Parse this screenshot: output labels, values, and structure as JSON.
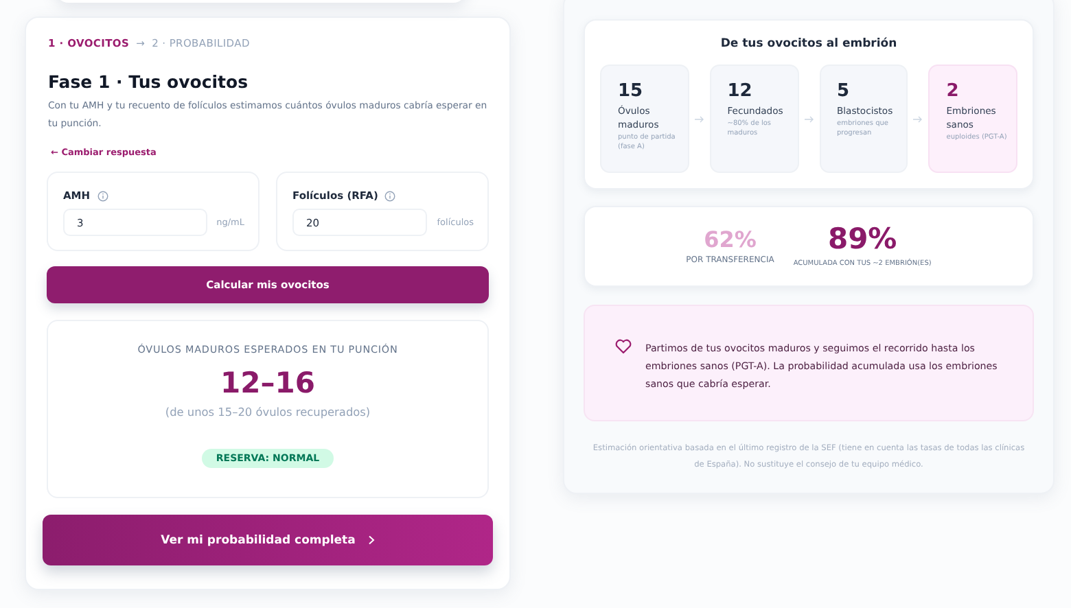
{
  "steps": [
    {
      "label": "1 · OVOCITOS",
      "selected": true
    },
    {
      "label": "2 · PROBABILIDAD",
      "selected": false
    }
  ],
  "step_separator": "→",
  "title": "Fase 1 · Tus ovocitos",
  "description": "Con tu AMH y tu recuento de folículos estimamos cuántos óvulos maduros cabría esperar en tu punción.",
  "back_link": "← Cambiar respuesta",
  "inputs": [
    {
      "label": "AMH",
      "value": "3",
      "unit": "ng/mL"
    },
    {
      "label": "Folículos (RFA)",
      "value": "20",
      "unit": "folículos"
    }
  ],
  "calculate_button": "Calcular mis ovocitos",
  "result": {
    "heading": "ÓVULOS MADUROS ESPERADOS EN TU PUNCIÓN",
    "range": "12–16",
    "note": "(de unos 15–20 óvulos recuperados)",
    "badge": "RESERVA: NORMAL"
  },
  "continue_button": "Ver mi probabilidad completa",
  "funnel": {
    "title": "De tus ovocitos al embrión",
    "stages": [
      {
        "kind": "step",
        "count": "15",
        "label": "Óvulos maduros",
        "detail": "punto de partida (fase A)"
      },
      {
        "kind": "step",
        "count": "12",
        "label": "Fecundados",
        "detail": "~80% de los maduros"
      },
      {
        "kind": "step",
        "count": "5",
        "label": "Blastocistos",
        "detail": "embriones que progresan"
      },
      {
        "kind": "final",
        "count": "2",
        "label": "Embriones sanos",
        "detail": "euploides (PGT-A)"
      }
    ]
  },
  "stats": [
    {
      "kind": "secondary",
      "value": "62%",
      "label": "POR TRANSFERENCIA"
    },
    {
      "kind": "primary",
      "value": "89%",
      "label": "ACUMULADA CON TUS ~2 EMBRIÓN(ES)"
    }
  ],
  "info": "Partimos de tus ovocitos maduros y seguimos el recorrido hasta los embriones sanos (PGT-A). La probabilidad acumulada usa los embriones sanos que cabría esperar.",
  "disclaimer": "Estimación orientativa basada en el último registro de la SEF (tiene en cuenta las tasas de todas las clínicas de España). No sustituye el consejo de tu equipo médico."
}
